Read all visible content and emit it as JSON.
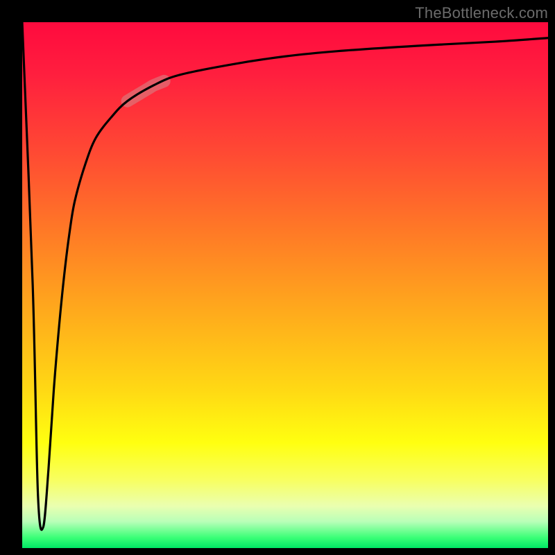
{
  "attribution": "TheBottleneck.com",
  "chart_data": {
    "type": "line",
    "title": "",
    "xlabel": "",
    "ylabel": "",
    "xlim": [
      0,
      100
    ],
    "ylim": [
      0,
      100
    ],
    "series": [
      {
        "name": "curve",
        "x": [
          0,
          2,
          3,
          4,
          5,
          6,
          7,
          8,
          9,
          10,
          12,
          14,
          17,
          20,
          25,
          30,
          40,
          50,
          60,
          75,
          90,
          100
        ],
        "y": [
          100,
          50,
          10,
          4,
          15,
          30,
          42,
          52,
          60,
          66,
          73,
          78,
          82,
          85,
          88,
          90,
          92,
          93.5,
          94.5,
          95.5,
          96.3,
          97
        ]
      }
    ],
    "highlight": {
      "series": "curve",
      "x_range": [
        20,
        27
      ],
      "comment": "faint thick pink band along the curve"
    },
    "background_gradient": {
      "direction": "top-to-bottom",
      "stops": [
        {
          "pos": 0.0,
          "color": "#ff0a3e"
        },
        {
          "pos": 0.55,
          "color": "#ffaa1c"
        },
        {
          "pos": 0.8,
          "color": "#ffff10"
        },
        {
          "pos": 1.0,
          "color": "#00e765"
        }
      ]
    }
  }
}
